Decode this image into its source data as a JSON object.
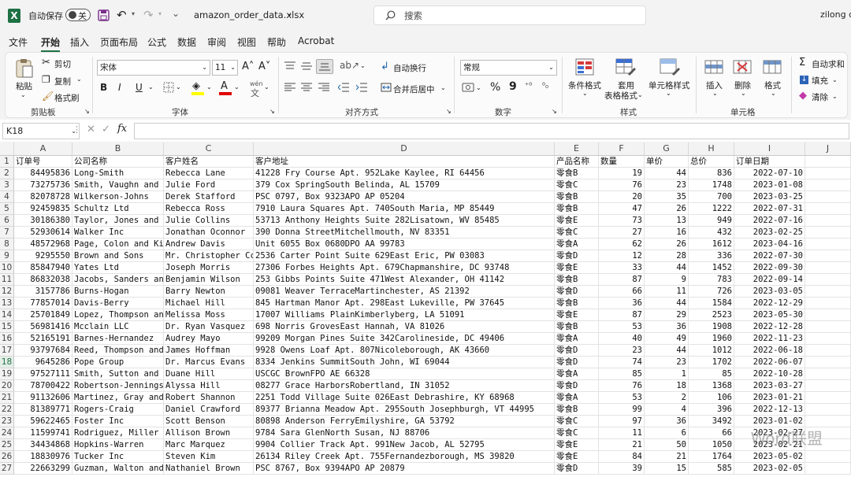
{
  "titlebar": {
    "autosave_label": "自动保存",
    "autosave_state": "关",
    "filename": "amazon_order_data.xlsx",
    "search_placeholder": "搜索",
    "user": "zilong d"
  },
  "menu": [
    "文件",
    "开始",
    "插入",
    "页面布局",
    "公式",
    "数据",
    "审阅",
    "视图",
    "帮助",
    "Acrobat"
  ],
  "ribbon": {
    "clipboard": {
      "paste": "粘贴",
      "cut": "剪切",
      "copy": "复制",
      "format_painter": "格式刷",
      "group": "剪贴板"
    },
    "font": {
      "name": "宋体",
      "size": "11",
      "bold": "B",
      "italic": "I",
      "underline": "U",
      "group": "字体",
      "increase": "Aˆ",
      "decrease": "Aˇ"
    },
    "alignment": {
      "wrap": "自动换行",
      "merge": "合并后居中",
      "group": "对齐方式"
    },
    "number": {
      "format": "常规",
      "percent": "%",
      "comma": "9",
      "group": "数字"
    },
    "styles": {
      "conditional": "条件格式",
      "table": "套用",
      "table2": "表格格式",
      "cell_styles": "单元格样式",
      "group": "样式"
    },
    "cells": {
      "insert": "插入",
      "delete": "删除",
      "format": "格式",
      "group": "单元格"
    },
    "editing": {
      "autosum": "自动求和",
      "fill": "填充",
      "clear": "清除"
    }
  },
  "formula_bar": {
    "name_box": "K18",
    "fx": "fx"
  },
  "columns": [
    "A",
    "B",
    "C",
    "D",
    "E",
    "F",
    "G",
    "H",
    "I",
    "J"
  ],
  "header_row": [
    "订单号",
    "公司名称",
    "客户姓名",
    "客户地址",
    "产品名称",
    "数量",
    "单价",
    "总价",
    "订单日期"
  ],
  "rows": [
    [
      "84495836",
      "Long-Smith",
      "Rebecca Lane",
      "41228 Fry Course Apt. 952Lake Kaylee, RI 64456",
      "零食B",
      "19",
      "44",
      "836",
      "2022-07-10"
    ],
    [
      "73275736",
      "Smith, Vaughn and",
      "Julie Ford",
      "379 Cox SpringSouth Belinda, AL 15709",
      "零食C",
      "76",
      "23",
      "1748",
      "2023-01-08"
    ],
    [
      "82078728",
      "Wilkerson-Johns",
      "Derek Stafford",
      "PSC 0797, Box 9323APO AP 05204",
      "零食B",
      "20",
      "35",
      "700",
      "2023-03-25"
    ],
    [
      "92459835",
      "Schultz Ltd",
      "Rebecca Ross",
      "7910 Laura Squares Apt. 740South Maria, MP 85449",
      "零食B",
      "47",
      "26",
      "1222",
      "2022-07-31"
    ],
    [
      "30186380",
      "Taylor, Jones and",
      "Julie Collins",
      "53713 Anthony Heights Suite 282Lisatown, WV 85485",
      "零食E",
      "73",
      "13",
      "949",
      "2022-07-16"
    ],
    [
      "52930614",
      "Walker Inc",
      "Jonathan Oconnor",
      "390 Donna StreetMitchellmouth, NV 83351",
      "零食C",
      "27",
      "16",
      "432",
      "2023-02-25"
    ],
    [
      "48572968",
      "Page, Colon and Ki",
      "Andrew Davis",
      "Unit 6055 Box 0680DPO AA 99783",
      "零食A",
      "62",
      "26",
      "1612",
      "2023-04-16"
    ],
    [
      "9295550",
      "Brown and Sons",
      "Mr. Christopher Cc",
      "2536 Carter Point Suite 629East Eric, PW 03083",
      "零食D",
      "12",
      "28",
      "336",
      "2022-07-30"
    ],
    [
      "85847940",
      "Yates Ltd",
      "Joseph Morris",
      "27306 Forbes Heights Apt. 679Chapmanshire, DC 93748",
      "零食E",
      "33",
      "44",
      "1452",
      "2022-09-30"
    ],
    [
      "86832038",
      "Jacobs, Sanders and",
      "Benjamin Wilson",
      "253 Gibbs Points Suite 471West Alexander, OH 41142",
      "零食B",
      "87",
      "9",
      "783",
      "2022-09-14"
    ],
    [
      "3157786",
      "Burns-Hogan",
      "Barry Newton",
      "09081 Weaver TerraceMartinchester, AS 21392",
      "零食D",
      "66",
      "11",
      "726",
      "2023-03-05"
    ],
    [
      "77857014",
      "Davis-Berry",
      "Michael Hill",
      "845 Hartman Manor Apt. 298East Lukeville, PW 37645",
      "零食B",
      "36",
      "44",
      "1584",
      "2022-12-29"
    ],
    [
      "25701849",
      "Lopez, Thompson and",
      "Melissa Moss",
      "17007 Williams PlainKimberlyberg, LA 51091",
      "零食E",
      "87",
      "29",
      "2523",
      "2023-05-30"
    ],
    [
      "56981416",
      "Mcclain LLC",
      "Dr. Ryan Vasquez",
      "698 Norris GrovesEast Hannah, VA 81026",
      "零食B",
      "53",
      "36",
      "1908",
      "2022-12-28"
    ],
    [
      "52165191",
      "Barnes-Hernandez",
      "Audrey Mayo",
      "99209 Morgan Pines Suite 342Carolineside, DC 49406",
      "零食A",
      "40",
      "49",
      "1960",
      "2022-11-23"
    ],
    [
      "93797684",
      "Reed, Thompson and",
      "James Hoffman",
      "9928 Owens Loaf Apt. 807Nicoleborough, AK 43660",
      "零食D",
      "23",
      "44",
      "1012",
      "2022-06-18"
    ],
    [
      "9645286",
      "Pope Group",
      "Dr. Marcus Evans",
      "8334 Jenkins SummitSouth John, WI 69044",
      "零食D",
      "74",
      "23",
      "1702",
      "2022-06-07"
    ],
    [
      "97527111",
      "Smith, Sutton and",
      "Duane Hill",
      "USCGC BrownFPO AE 66328",
      "零食A",
      "85",
      "1",
      "85",
      "2022-10-28"
    ],
    [
      "78700422",
      "Robertson-Jennings",
      "Alyssa Hill",
      "08277 Grace HarborsRobertland, IN 31052",
      "零食D",
      "76",
      "18",
      "1368",
      "2023-03-27"
    ],
    [
      "91132606",
      "Martinez, Gray and",
      "Robert Shannon",
      "2251 Todd Village Suite 026East Debrashire, KY 68968",
      "零食A",
      "53",
      "2",
      "106",
      "2023-01-21"
    ],
    [
      "81389771",
      "Rogers-Craig",
      "Daniel Crawford",
      "89377 Brianna Meadow Apt. 295South Josephburgh, VT 44995",
      "零食B",
      "99",
      "4",
      "396",
      "2022-12-13"
    ],
    [
      "59622465",
      "Foster Inc",
      "Scott Benson",
      "80898 Anderson FerryEmilyshire, GA 53792",
      "零食C",
      "97",
      "36",
      "3492",
      "2023-01-02"
    ],
    [
      "11599741",
      "Rodriguez, Miller a",
      "Allison Brown",
      "9784 Sara GlenNorth Susan, NJ 88706",
      "零食C",
      "11",
      "6",
      "66",
      "2023-02-27"
    ],
    [
      "34434868",
      "Hopkins-Warren",
      "Marc Marquez",
      "9904 Collier Track Apt. 991New Jacob, AL 52795",
      "零食E",
      "21",
      "50",
      "1050",
      "2023-02-21"
    ],
    [
      "18830976",
      "Tucker Inc",
      "Steven Kim",
      "26134 Riley Creek Apt. 755Fernandezborough, MS 39820",
      "零食E",
      "84",
      "21",
      "1764",
      "2023-05-02"
    ],
    [
      "22663299",
      "Guzman, Walton and",
      "Nathaniel Brown",
      "PSC 8767, Box 9394APO AP 20879",
      "零食D",
      "39",
      "15",
      "585",
      "2023-02-05"
    ]
  ],
  "watermark": "Word联盟"
}
